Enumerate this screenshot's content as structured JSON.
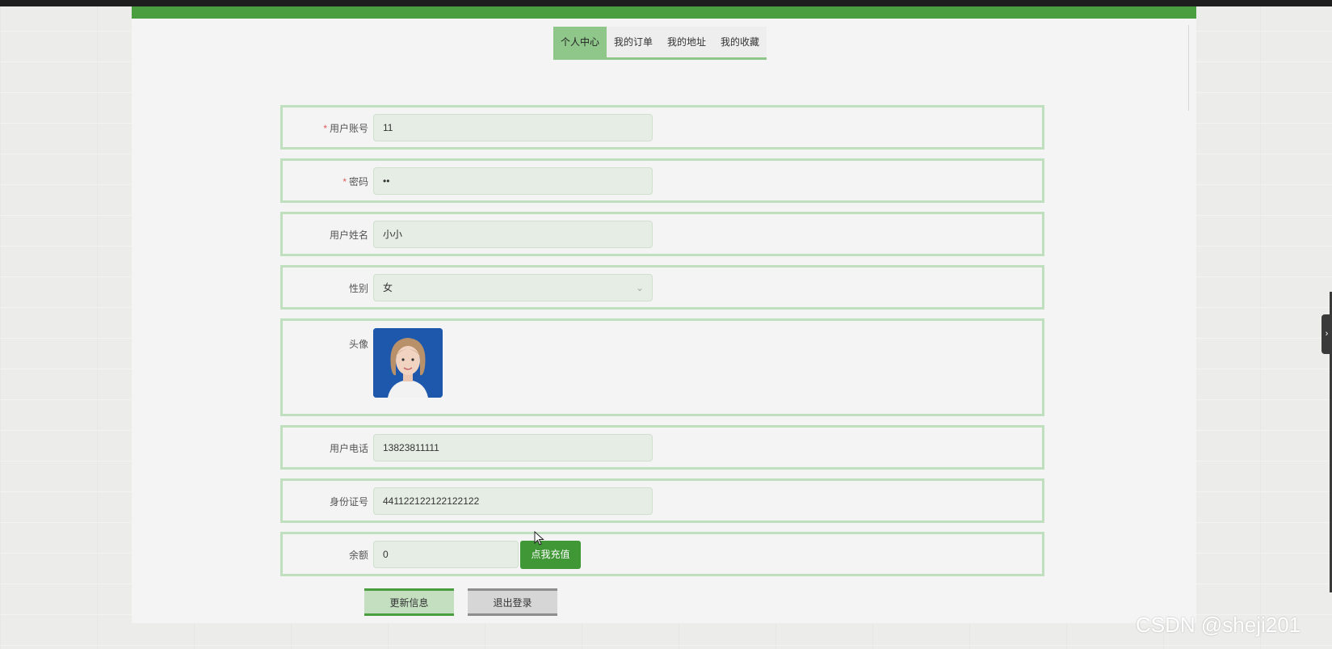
{
  "tabs": [
    {
      "label": "个人中心",
      "active": true
    },
    {
      "label": "我的订单",
      "active": false
    },
    {
      "label": "我的地址",
      "active": false
    },
    {
      "label": "我的收藏",
      "active": false
    }
  ],
  "form": {
    "account": {
      "label": "用户账号",
      "required": true,
      "value": "11"
    },
    "password": {
      "label": "密码",
      "required": true,
      "value": "••"
    },
    "name": {
      "label": "用户姓名",
      "value": "小小"
    },
    "gender": {
      "label": "性别",
      "value": "女"
    },
    "avatar": {
      "label": "头像"
    },
    "phone": {
      "label": "用户电话",
      "value": "13823811111"
    },
    "id_number": {
      "label": "身份证号",
      "value": "441122122122122122"
    },
    "balance": {
      "label": "余额",
      "value": "0",
      "recharge_label": "点我充值"
    }
  },
  "buttons": {
    "update": "更新信息",
    "logout": "退出登录"
  },
  "watermark": "CSDN @sheji201",
  "colors": {
    "brand_green": "#4a9e3f",
    "tab_active": "#8fc68a",
    "row_border": "#c0dfbe",
    "input_bg": "#e5ede4",
    "required": "#e15b5b"
  },
  "icons": {
    "select_arrow": "chevron-down-icon",
    "side_toggle": "chevron-right-icon",
    "cursor": "mouse-pointer-icon"
  }
}
